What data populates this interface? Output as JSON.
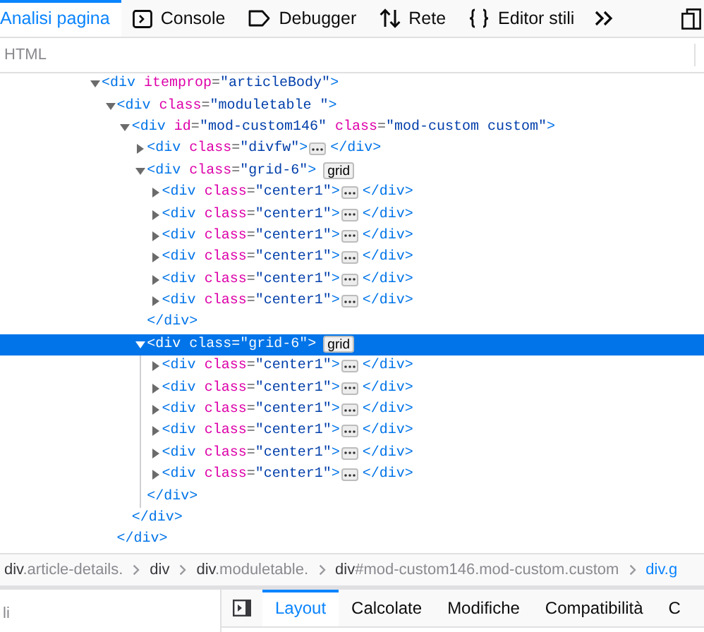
{
  "toolbar": {
    "tabs": [
      {
        "label": "Analisi pagina",
        "selected": true
      },
      {
        "label": "Console",
        "selected": false
      },
      {
        "label": "Debugger",
        "selected": false
      },
      {
        "label": "Rete",
        "selected": false
      },
      {
        "label": "Editor stili",
        "selected": false
      }
    ]
  },
  "panel_header": {
    "title": "HTML"
  },
  "tree": [
    {
      "tokens": [
        {
          "kind": "tag",
          "text": "<div"
        },
        {
          "kind": "attr",
          "text": " itemprop"
        },
        {
          "kind": "punct",
          "text": "="
        },
        {
          "kind": "value",
          "text": "\"articleBody\""
        },
        {
          "kind": "tag",
          "text": ">"
        }
      ],
      "expanded": true,
      "selected": false,
      "children": [
        {
          "tokens": [
            {
              "kind": "tag",
              "text": "<div"
            },
            {
              "kind": "attr",
              "text": " class"
            },
            {
              "kind": "punct",
              "text": "="
            },
            {
              "kind": "value",
              "text": "\"moduletable \""
            },
            {
              "kind": "tag",
              "text": ">"
            }
          ],
          "expanded": true,
          "selected": false,
          "children": [
            {
              "tokens": [
                {
                  "kind": "tag",
                  "text": "<div"
                },
                {
                  "kind": "attr",
                  "text": " id"
                },
                {
                  "kind": "punct",
                  "text": "="
                },
                {
                  "kind": "value",
                  "text": "\"mod-custom146\""
                },
                {
                  "kind": "attr",
                  "text": " class"
                },
                {
                  "kind": "punct",
                  "text": "="
                },
                {
                  "kind": "value",
                  "text": "\"mod-custom custom\""
                },
                {
                  "kind": "tag",
                  "text": ">"
                }
              ],
              "expanded": true,
              "selected": false,
              "children": [
                {
                  "tokens": [
                    {
                      "kind": "tag",
                      "text": "<div"
                    },
                    {
                      "kind": "attr",
                      "text": " class"
                    },
                    {
                      "kind": "punct",
                      "text": "="
                    },
                    {
                      "kind": "value",
                      "text": "\"divfw\""
                    },
                    {
                      "kind": "tag",
                      "text": ">"
                    }
                  ],
                  "expanded": false,
                  "selected": false,
                  "close": "</div>"
                },
                {
                  "tokens": [
                    {
                      "kind": "tag",
                      "text": "<div"
                    },
                    {
                      "kind": "attr",
                      "text": " class"
                    },
                    {
                      "kind": "punct",
                      "text": "="
                    },
                    {
                      "kind": "value",
                      "text": "\"grid-6\""
                    },
                    {
                      "kind": "tag",
                      "text": ">"
                    }
                  ],
                  "badge": "grid",
                  "expanded": true,
                  "selected": false,
                  "children": [
                    {
                      "tokens": [
                        {
                          "kind": "tag",
                          "text": "<div"
                        },
                        {
                          "kind": "attr",
                          "text": " class"
                        },
                        {
                          "kind": "punct",
                          "text": "="
                        },
                        {
                          "kind": "value",
                          "text": "\"center1\""
                        },
                        {
                          "kind": "tag",
                          "text": ">"
                        }
                      ],
                      "expanded": false,
                      "selected": false,
                      "close": "</div>"
                    },
                    {
                      "tokens": [
                        {
                          "kind": "tag",
                          "text": "<div"
                        },
                        {
                          "kind": "attr",
                          "text": " class"
                        },
                        {
                          "kind": "punct",
                          "text": "="
                        },
                        {
                          "kind": "value",
                          "text": "\"center1\""
                        },
                        {
                          "kind": "tag",
                          "text": ">"
                        }
                      ],
                      "expanded": false,
                      "selected": false,
                      "close": "</div>"
                    },
                    {
                      "tokens": [
                        {
                          "kind": "tag",
                          "text": "<div"
                        },
                        {
                          "kind": "attr",
                          "text": " class"
                        },
                        {
                          "kind": "punct",
                          "text": "="
                        },
                        {
                          "kind": "value",
                          "text": "\"center1\""
                        },
                        {
                          "kind": "tag",
                          "text": ">"
                        }
                      ],
                      "expanded": false,
                      "selected": false,
                      "close": "</div>"
                    },
                    {
                      "tokens": [
                        {
                          "kind": "tag",
                          "text": "<div"
                        },
                        {
                          "kind": "attr",
                          "text": " class"
                        },
                        {
                          "kind": "punct",
                          "text": "="
                        },
                        {
                          "kind": "value",
                          "text": "\"center1\""
                        },
                        {
                          "kind": "tag",
                          "text": ">"
                        }
                      ],
                      "expanded": false,
                      "selected": false,
                      "close": "</div>"
                    },
                    {
                      "tokens": [
                        {
                          "kind": "tag",
                          "text": "<div"
                        },
                        {
                          "kind": "attr",
                          "text": " class"
                        },
                        {
                          "kind": "punct",
                          "text": "="
                        },
                        {
                          "kind": "value",
                          "text": "\"center1\""
                        },
                        {
                          "kind": "tag",
                          "text": ">"
                        }
                      ],
                      "expanded": false,
                      "selected": false,
                      "close": "</div>"
                    },
                    {
                      "tokens": [
                        {
                          "kind": "tag",
                          "text": "<div"
                        },
                        {
                          "kind": "attr",
                          "text": " class"
                        },
                        {
                          "kind": "punct",
                          "text": "="
                        },
                        {
                          "kind": "value",
                          "text": "\"center1\""
                        },
                        {
                          "kind": "tag",
                          "text": ">"
                        }
                      ],
                      "expanded": false,
                      "selected": false,
                      "close": "</div>"
                    }
                  ],
                  "close": "</div>"
                },
                {
                  "tokens": [
                    {
                      "kind": "tag",
                      "text": "<div"
                    },
                    {
                      "kind": "attr",
                      "text": " class"
                    },
                    {
                      "kind": "punct",
                      "text": "="
                    },
                    {
                      "kind": "value",
                      "text": "\"grid-6\""
                    },
                    {
                      "kind": "tag",
                      "text": ">"
                    }
                  ],
                  "badge": "grid",
                  "expanded": true,
                  "selected": true,
                  "children": [
                    {
                      "tokens": [
                        {
                          "kind": "tag",
                          "text": "<div"
                        },
                        {
                          "kind": "attr",
                          "text": " class"
                        },
                        {
                          "kind": "punct",
                          "text": "="
                        },
                        {
                          "kind": "value",
                          "text": "\"center1\""
                        },
                        {
                          "kind": "tag",
                          "text": ">"
                        }
                      ],
                      "expanded": false,
                      "selected": false,
                      "close": "</div>"
                    },
                    {
                      "tokens": [
                        {
                          "kind": "tag",
                          "text": "<div"
                        },
                        {
                          "kind": "attr",
                          "text": " class"
                        },
                        {
                          "kind": "punct",
                          "text": "="
                        },
                        {
                          "kind": "value",
                          "text": "\"center1\""
                        },
                        {
                          "kind": "tag",
                          "text": ">"
                        }
                      ],
                      "expanded": false,
                      "selected": false,
                      "close": "</div>"
                    },
                    {
                      "tokens": [
                        {
                          "kind": "tag",
                          "text": "<div"
                        },
                        {
                          "kind": "attr",
                          "text": " class"
                        },
                        {
                          "kind": "punct",
                          "text": "="
                        },
                        {
                          "kind": "value",
                          "text": "\"center1\""
                        },
                        {
                          "kind": "tag",
                          "text": ">"
                        }
                      ],
                      "expanded": false,
                      "selected": false,
                      "close": "</div>"
                    },
                    {
                      "tokens": [
                        {
                          "kind": "tag",
                          "text": "<div"
                        },
                        {
                          "kind": "attr",
                          "text": " class"
                        },
                        {
                          "kind": "punct",
                          "text": "="
                        },
                        {
                          "kind": "value",
                          "text": "\"center1\""
                        },
                        {
                          "kind": "tag",
                          "text": ">"
                        }
                      ],
                      "expanded": false,
                      "selected": false,
                      "close": "</div>"
                    },
                    {
                      "tokens": [
                        {
                          "kind": "tag",
                          "text": "<div"
                        },
                        {
                          "kind": "attr",
                          "text": " class"
                        },
                        {
                          "kind": "punct",
                          "text": "="
                        },
                        {
                          "kind": "value",
                          "text": "\"center1\""
                        },
                        {
                          "kind": "tag",
                          "text": ">"
                        }
                      ],
                      "expanded": false,
                      "selected": false,
                      "close": "</div>"
                    },
                    {
                      "tokens": [
                        {
                          "kind": "tag",
                          "text": "<div"
                        },
                        {
                          "kind": "attr",
                          "text": " class"
                        },
                        {
                          "kind": "punct",
                          "text": "="
                        },
                        {
                          "kind": "value",
                          "text": "\"center1\""
                        },
                        {
                          "kind": "tag",
                          "text": ">"
                        }
                      ],
                      "expanded": false,
                      "selected": false,
                      "close": "</div>"
                    }
                  ],
                  "close": "</div>"
                }
              ],
              "close": "</div>"
            }
          ],
          "close": "</div>"
        }
      ]
    }
  ],
  "breadcrumbs": [
    {
      "tag": "div",
      "rest": ".article-details.",
      "selected": false
    },
    {
      "tag": "div",
      "selected": false
    },
    {
      "tag": "div",
      "rest": ".moduletable.",
      "selected": false
    },
    {
      "tag": "div",
      "rest": "#mod-custom146.mod-custom.custom",
      "selected": false
    },
    {
      "tag": "div.g",
      "selected": true
    }
  ],
  "left_pane": {
    "text": "li"
  },
  "sidebar": {
    "tabs": [
      {
        "label": "Layout",
        "selected": true
      },
      {
        "label": "Calcolate",
        "selected": false
      },
      {
        "label": "Modifiche",
        "selected": false
      },
      {
        "label": "Compatibilità",
        "selected": false
      },
      {
        "label": "C",
        "selected": false
      }
    ]
  }
}
